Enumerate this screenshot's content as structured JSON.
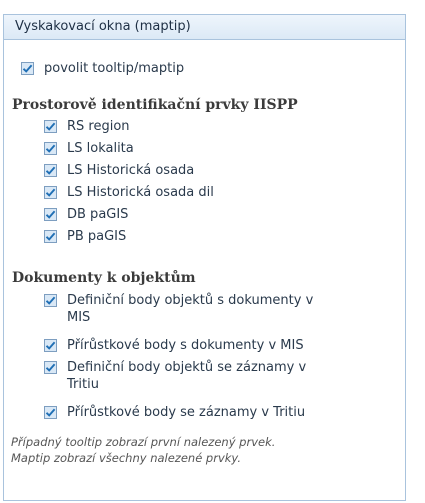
{
  "panel": {
    "title": "Vyskakovací okna (maptip)",
    "enable_label": "povolit tooltip/maptip",
    "enable_checked": true
  },
  "sections": [
    {
      "title": "Prostorově identifikační prvky IISPP",
      "items": [
        {
          "label": "RS region",
          "checked": true
        },
        {
          "label": "LS lokalita",
          "checked": true
        },
        {
          "label": "LS Historická osada",
          "checked": true
        },
        {
          "label": "LS Historická osada dil",
          "checked": true
        },
        {
          "label": "DB paGIS",
          "checked": true
        },
        {
          "label": "PB paGIS",
          "checked": true
        }
      ]
    },
    {
      "title": "Dokumenty k objektům",
      "items": [
        {
          "label_lines": [
            "Definiční body objektů s dokumenty v",
            "MIS"
          ],
          "checked": true
        },
        {
          "label_lines": [
            "Přírůstkové body s dokumenty v MIS"
          ],
          "checked": true
        },
        {
          "label_lines": [
            "Definiční body objektů se záznamy v",
            "Tritiu"
          ],
          "checked": true
        },
        {
          "label_lines": [
            "Přírůstkové body se záznamy v Tritiu"
          ],
          "checked": true
        }
      ]
    }
  ],
  "note": {
    "line1": "Případný tooltip zobrazí první nalezený prvek.",
    "line2": "Maptip zobrazí všechny nalezené prvky."
  },
  "colors": {
    "accent": "#1f6fb5",
    "border": "#a9c3dd"
  },
  "icons": {
    "checkbox_checked": "check-icon"
  }
}
